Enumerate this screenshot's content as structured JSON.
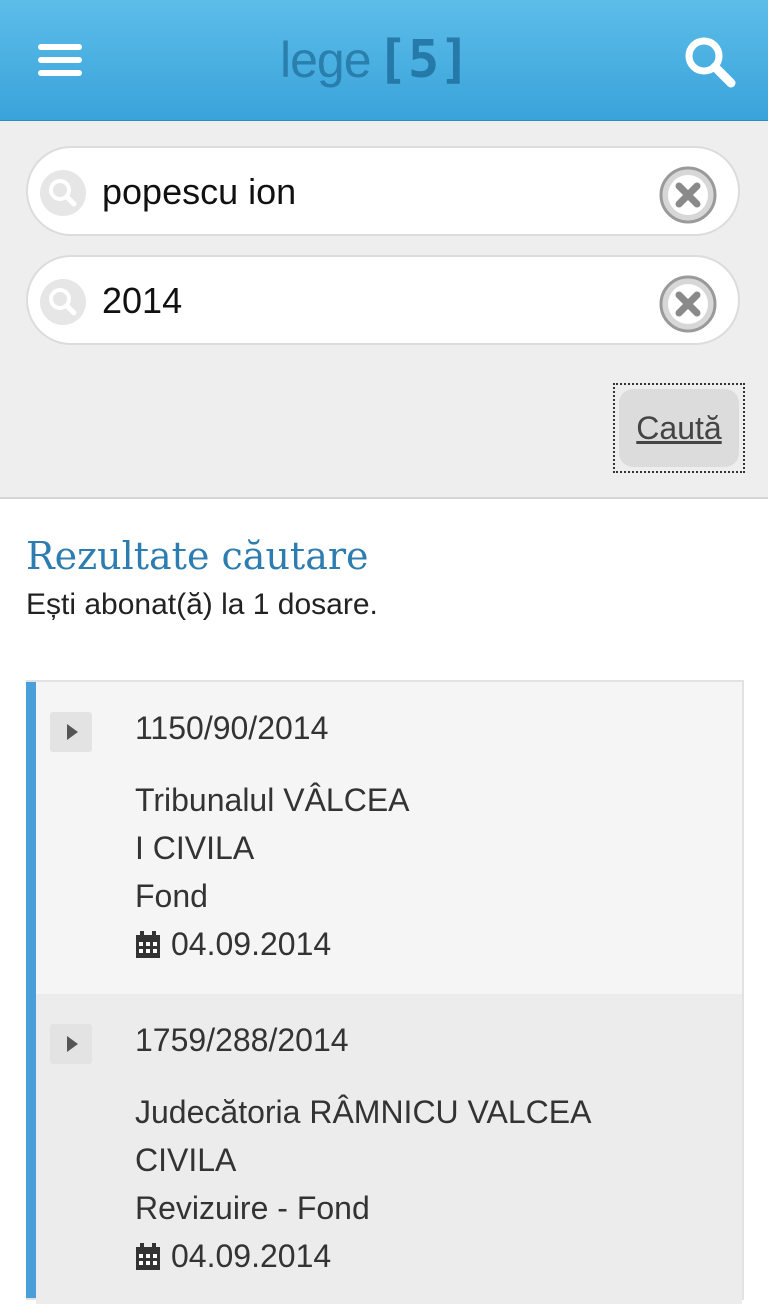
{
  "header": {
    "logo_text": "lege",
    "logo_number": "[5]",
    "menu_icon": "hamburger-menu-icon",
    "search_icon": "search-icon"
  },
  "search": {
    "name_value": "popescu ion",
    "year_value": "2014",
    "submit_label": "Caută"
  },
  "results": {
    "title": "Rezultate căutare",
    "subscription_text": "Ești abonat(ă) la 1 dosare.",
    "items": [
      {
        "case_number": "1150/90/2014",
        "court": "Tribunalul VÂLCEA",
        "section": "I CIVILA",
        "stage": "Fond",
        "date": "04.09.2014"
      },
      {
        "case_number": "1759/288/2014",
        "court": "Judecătoria RÂMNICU VALCEA",
        "section": "CIVILA",
        "stage": "Revizuire - Fond",
        "date": "04.09.2014"
      }
    ]
  },
  "colors": {
    "header_blue": "#3aa3da",
    "accent_blue": "#2d7db0",
    "list_bar": "#4a9fd8"
  }
}
